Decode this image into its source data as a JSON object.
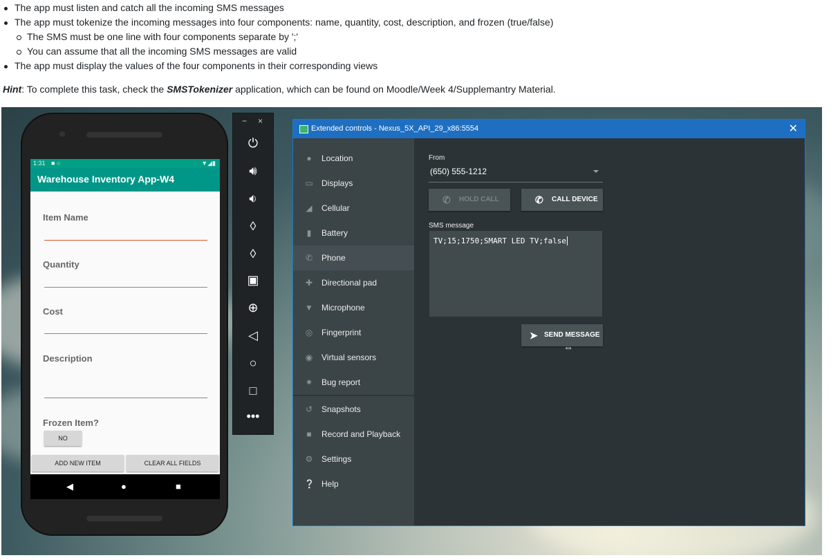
{
  "doc": {
    "bullets": [
      "The app must listen and catch all the incoming SMS messages",
      "The app must tokenize the incoming messages into four components: name, quantity, cost, description, and frozen (true/false)",
      "The SMS must be one line with four components separate by ';'",
      "You can assume that all the incoming SMS messages are valid",
      "The app must display the values of the four components in their corresponding views"
    ],
    "hint_label": "Hint",
    "hint_pre": ": To complete this task, check the ",
    "hint_app": "SMSTokenizer",
    "hint_post": " application, which can be found on Moodle/Week 4/Supplemantry Material."
  },
  "phone": {
    "status_time": "1:31",
    "app_title": "Warehouse Inventory App-W4",
    "fields": [
      "Item Name",
      "Quantity",
      "Cost",
      "Description",
      "Frozen Item?"
    ],
    "frozen_toggle": "NO",
    "add_button": "ADD NEW ITEM",
    "clear_button": "CLEAR ALL FIELDS"
  },
  "toolbar": {
    "minimize": "−",
    "close": "×"
  },
  "extended": {
    "title": "Extended controls - Nexus_5X_API_29_x86:5554",
    "nav": [
      {
        "label": "Location",
        "icon": "location-icon"
      },
      {
        "label": "Displays",
        "icon": "displays-icon"
      },
      {
        "label": "Cellular",
        "icon": "cellular-icon"
      },
      {
        "label": "Battery",
        "icon": "battery-icon"
      },
      {
        "label": "Phone",
        "icon": "phone-icon"
      },
      {
        "label": "Directional pad",
        "icon": "dpad-icon"
      },
      {
        "label": "Microphone",
        "icon": "microphone-icon"
      },
      {
        "label": "Fingerprint",
        "icon": "fingerprint-icon"
      },
      {
        "label": "Virtual sensors",
        "icon": "sensors-icon"
      },
      {
        "label": "Bug report",
        "icon": "bug-icon"
      },
      {
        "label": "Snapshots",
        "icon": "snapshots-icon"
      },
      {
        "label": "Record and Playback",
        "icon": "record-icon"
      },
      {
        "label": "Settings",
        "icon": "gear-icon"
      },
      {
        "label": "Help",
        "icon": "help-icon"
      }
    ],
    "active_nav": "Phone",
    "from_label": "From",
    "from_value": "(650) 555-1212",
    "hold_call": "HOLD CALL",
    "call_device": "CALL DEVICE",
    "sms_label": "SMS message",
    "sms_value": "TV;15;1750;SMART LED TV;false",
    "send_message": "SEND MESSAGE"
  },
  "colors": {
    "app_bar": "#009688",
    "window_title": "#1e6fc1",
    "panel_bg": "#2c3336",
    "nav_bg": "#3b4447"
  }
}
